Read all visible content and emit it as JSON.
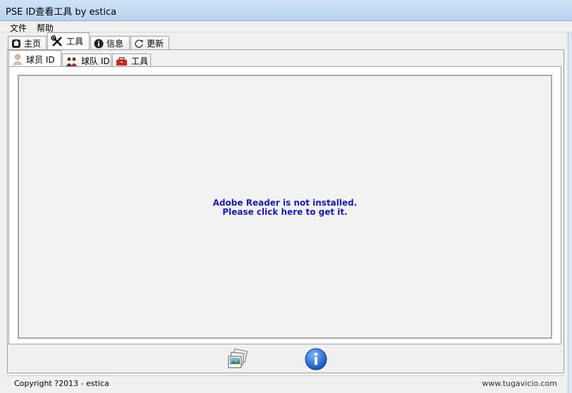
{
  "window": {
    "title": "PSE ID查看工具 by estica"
  },
  "menu": {
    "items": [
      "文件",
      "帮助"
    ]
  },
  "main_tabs": [
    {
      "label": "主页",
      "icon": "home-icon"
    },
    {
      "label": "工具",
      "icon": "tools-icon"
    },
    {
      "label": "信息",
      "icon": "info-icon"
    },
    {
      "label": "更新",
      "icon": "refresh-icon"
    }
  ],
  "sub_tabs": [
    {
      "label": "球员 ID",
      "icon": "player-icon"
    },
    {
      "label": "球队 ID",
      "icon": "team-icon"
    },
    {
      "label": "工具",
      "icon": "toolbox-icon"
    }
  ],
  "pdf": {
    "line1": "Adobe Reader is not installed.",
    "line2": "Please click here to get it."
  },
  "footer": {
    "copyright": "Copyright ?2013 - estica",
    "watermark": "www.tugavicio.com"
  },
  "bottom_buttons": [
    {
      "icon": "photo-icon"
    },
    {
      "icon": "info-circle-icon"
    }
  ]
}
